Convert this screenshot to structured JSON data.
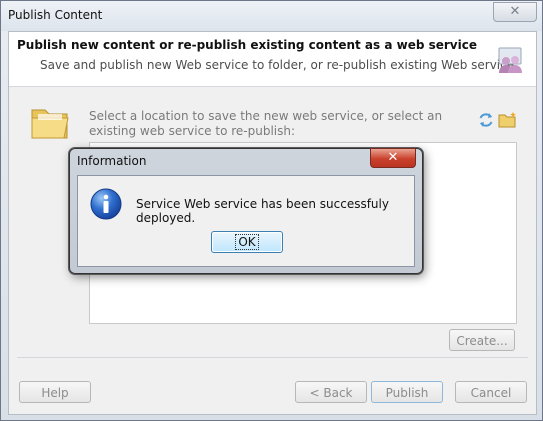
{
  "window": {
    "title": "Publish Content",
    "close_label": "✕"
  },
  "header": {
    "title": "Publish new content or re-publish existing content as a web service",
    "subtitle": "Save and publish new Web service to folder, or re-publish existing Web service",
    "icon": "users-icon"
  },
  "location": {
    "instruction": "Select a location to save the new web service, or select an existing web service to re-publish:",
    "folder_icon": "folder-icon",
    "refresh_icon": "refresh-icon",
    "new_folder_icon": "new-folder-icon"
  },
  "buttons": {
    "create": "Create...",
    "help": "Help",
    "back": "< Back",
    "publish": "Publish",
    "cancel": "Cancel"
  },
  "dialog": {
    "title": "Information",
    "close_label": "✕",
    "icon": "info-icon",
    "message": "Service Web service has been successfuly deployed.",
    "ok": "OK"
  },
  "colors": {
    "info_blue": "#1f5fbf",
    "close_red": "#c9412c",
    "folder_yellow": "#f3d26b"
  }
}
